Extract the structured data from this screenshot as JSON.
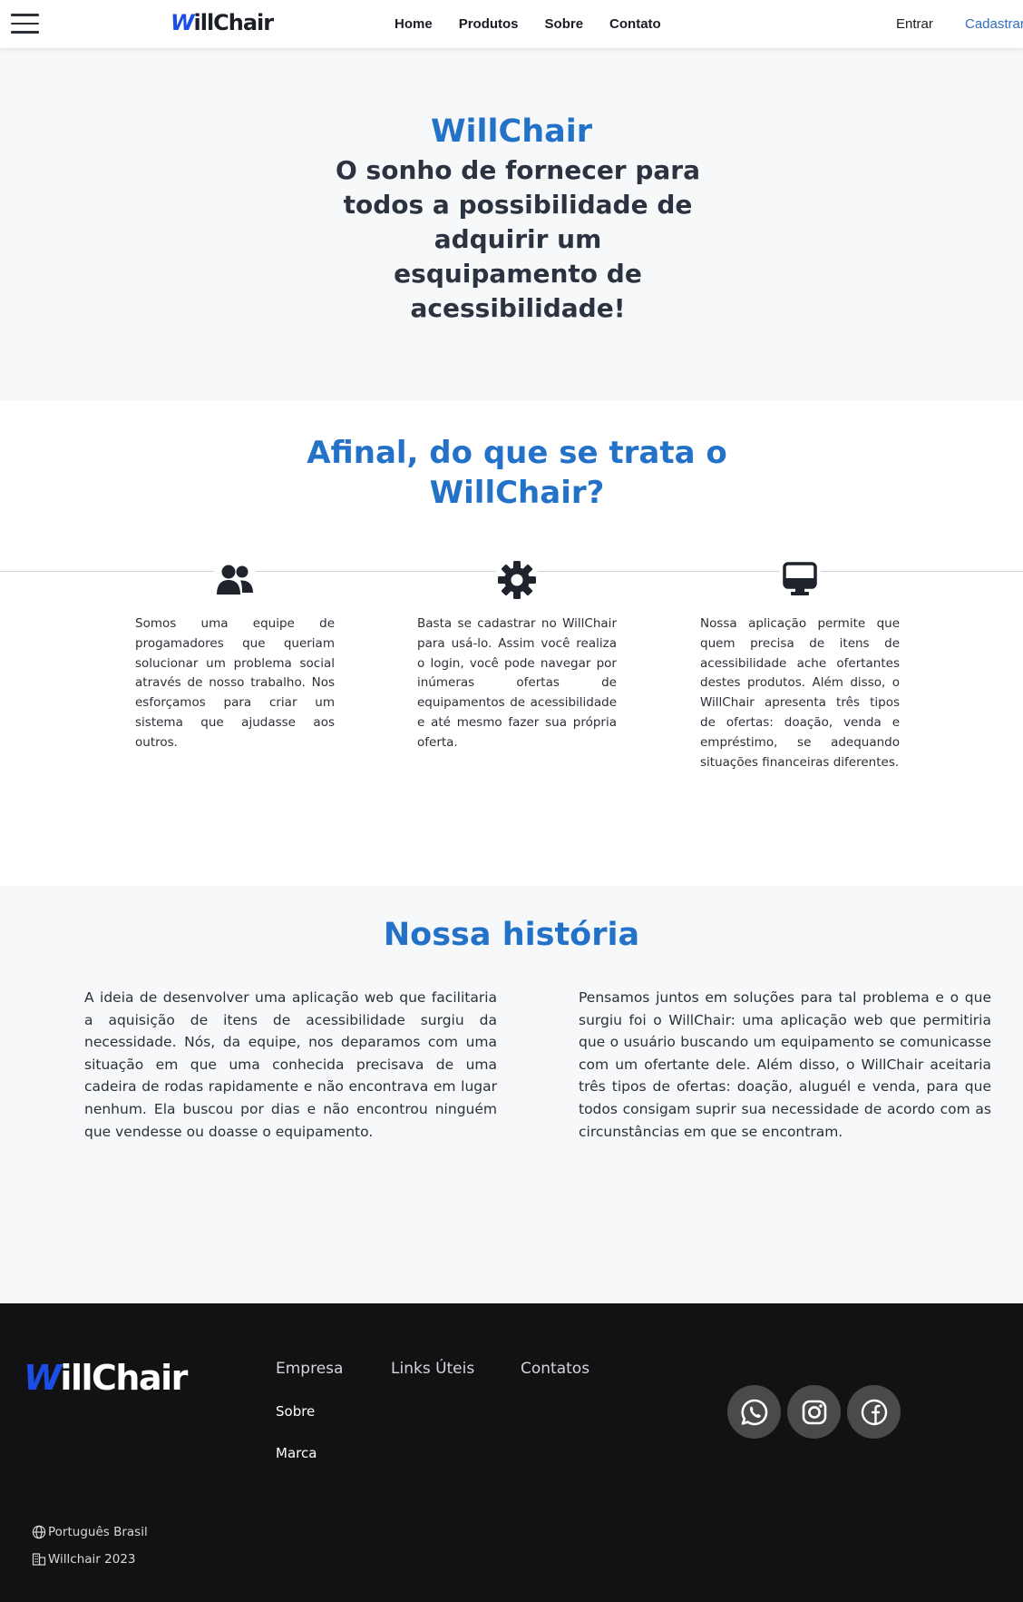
{
  "header": {
    "logo": {
      "first_letter": "W",
      "rest": "illChair"
    },
    "nav": [
      "Home",
      "Produtos",
      "Sobre",
      "Contato"
    ],
    "login_label": "Entrar",
    "signup_label": "Cadastrar",
    "accent_color": "#2f6fbd"
  },
  "hero": {
    "brand": "WillChair",
    "tagline": "O sonho de fornecer para todos a possibilidade de adquirir um esquipamento de acessibilidade!"
  },
  "about": {
    "title": "Afinal, do que se trata o WillChair?",
    "features": [
      {
        "icon": "users-icon",
        "text": "Somos uma equipe de progamadores que queriam solucionar um problema social através de nosso trabalho. Nos esforçamos para criar um sistema que ajudasse aos outros."
      },
      {
        "icon": "gear-icon",
        "text": "Basta se cadastrar no WillChair para usá-lo. Assim você realiza o login, você pode navegar por inúmeras ofertas de equipamentos de acessibilidade e até mesmo fazer sua própria oferta."
      },
      {
        "icon": "desktop-icon",
        "text": "Nossa aplicação permite que quem precisa de itens de acessibilidade ache ofertantes destes produtos. Além disso, o WillChair apresenta três tipos de ofertas: doação, venda e empréstimo, se adequando situações financeiras diferentes."
      }
    ]
  },
  "history": {
    "title": "Nossa história",
    "paragraphs": [
      "A ideia de desenvolver uma aplicação web que facilitaria a aquisição de itens de acessibilidade surgiu da necessidade. Nós, da equipe, nos deparamos com uma situação em que uma conhecida precisava de uma cadeira de rodas rapidamente e não encontrava em lugar nenhum. Ela buscou por dias e não encontrou ninguém que vendesse ou doasse o equipamento.",
      "Pensamos juntos em soluções para tal problema e o que surgiu foi o WillChair: uma aplicação web que permitiria que o usuário buscando um equipamento se comunicasse com um ofertante dele. Além disso, o WillChair aceitaria três tipos de ofertas: doação, aluguél e venda, para que todos consigam suprir sua necessidade de acordo com as circunstâncias em que se encontram."
    ]
  },
  "footer": {
    "logo": {
      "first_letter": "W",
      "rest": "illChair"
    },
    "columns": [
      "Empresa",
      "Links Úteis",
      "Contatos"
    ],
    "empresa_links": [
      "Sobre",
      "Marca"
    ],
    "social": [
      "whatsapp-icon",
      "instagram-icon",
      "facebook-icon"
    ],
    "language": "Português Brasil",
    "copyright": "Willchair 2023"
  }
}
